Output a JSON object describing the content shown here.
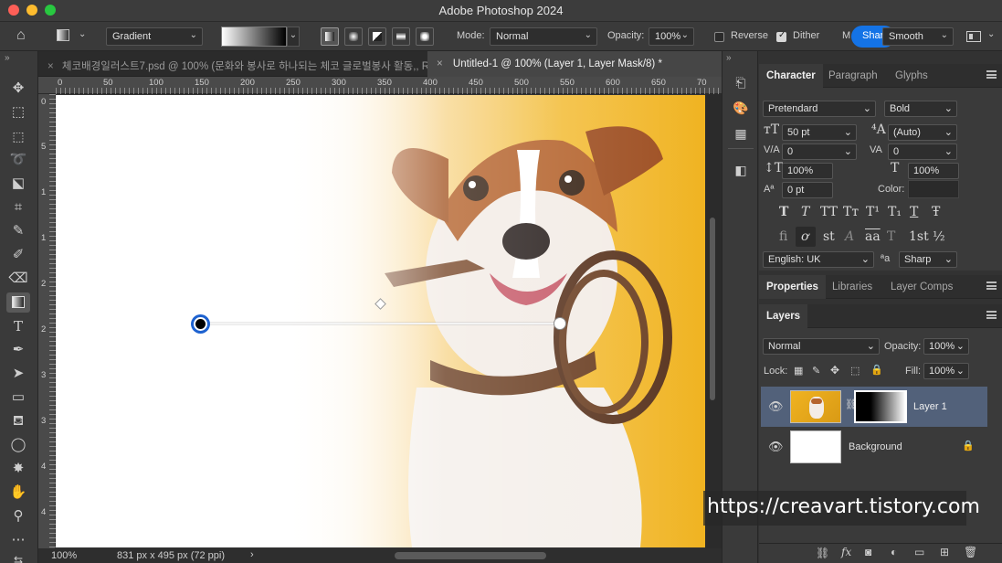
{
  "app_title": "Adobe Photoshop 2024",
  "options_bar": {
    "tool_preset_label": "Gradient",
    "mode_label": "Mode:",
    "mode_value": "Normal",
    "opacity_label": "Opacity:",
    "opacity_value": "100%",
    "reverse_label": "Reverse",
    "reverse_checked": false,
    "dither_label": "Dither",
    "dither_checked": true,
    "method_label": "M",
    "share_label": "Share",
    "smooth_value": "Smooth"
  },
  "tabs": [
    {
      "label": "체코배경일러스트7.psd @ 100% (문화와 봉사로 하나되는 체코 글로벌봉사 활동,, R...",
      "active": false
    },
    {
      "label": "Untitled-1 @ 100% (Layer 1, Layer Mask/8) *",
      "active": true
    }
  ],
  "ruler": {
    "h_ticks": [
      "0",
      "50",
      "100",
      "150",
      "200",
      "250",
      "300",
      "350",
      "400",
      "450",
      "500",
      "550",
      "600",
      "650",
      "70"
    ],
    "v_ticks": [
      "0",
      "5",
      "1",
      "1",
      "2",
      "2",
      "3",
      "3",
      "4",
      "4"
    ]
  },
  "status_bar": {
    "zoom": "100%",
    "doc_info": "831 px x 495 px (72 ppi)"
  },
  "character_panel": {
    "tabs": [
      "Character",
      "Paragraph",
      "Glyphs"
    ],
    "font_family": "Pretendard",
    "font_style": "Bold",
    "font_size": "50 pt",
    "leading": "(Auto)",
    "kerning": "0",
    "tracking": "0",
    "vertical_scale": "100%",
    "horizontal_scale": "100%",
    "baseline_shift": "0 pt",
    "color_label": "Color:",
    "type_styles": [
      "T",
      "T",
      "TT",
      "Tт",
      "T¹",
      "T₁",
      "T",
      "Ŧ"
    ],
    "opentype": [
      "fi",
      "ơ",
      "st",
      "A",
      "aa",
      "T",
      "1st",
      "½"
    ],
    "language": "English: UK",
    "aa_label": "ªa",
    "antialias": "Sharp"
  },
  "properties_tabs": [
    "Properties",
    "Libraries",
    "Layer Comps"
  ],
  "layers_panel": {
    "title": "Layers",
    "blend_mode": "Normal",
    "opacity_label": "Opacity:",
    "opacity_value": "100%",
    "lock_label": "Lock:",
    "fill_label": "Fill:",
    "fill_value": "100%",
    "layers": [
      {
        "name": "Layer 1",
        "selected": true,
        "has_mask": true
      },
      {
        "name": "Background",
        "selected": false,
        "locked": true
      }
    ]
  },
  "watermark": "https://creavart.tistory.com"
}
